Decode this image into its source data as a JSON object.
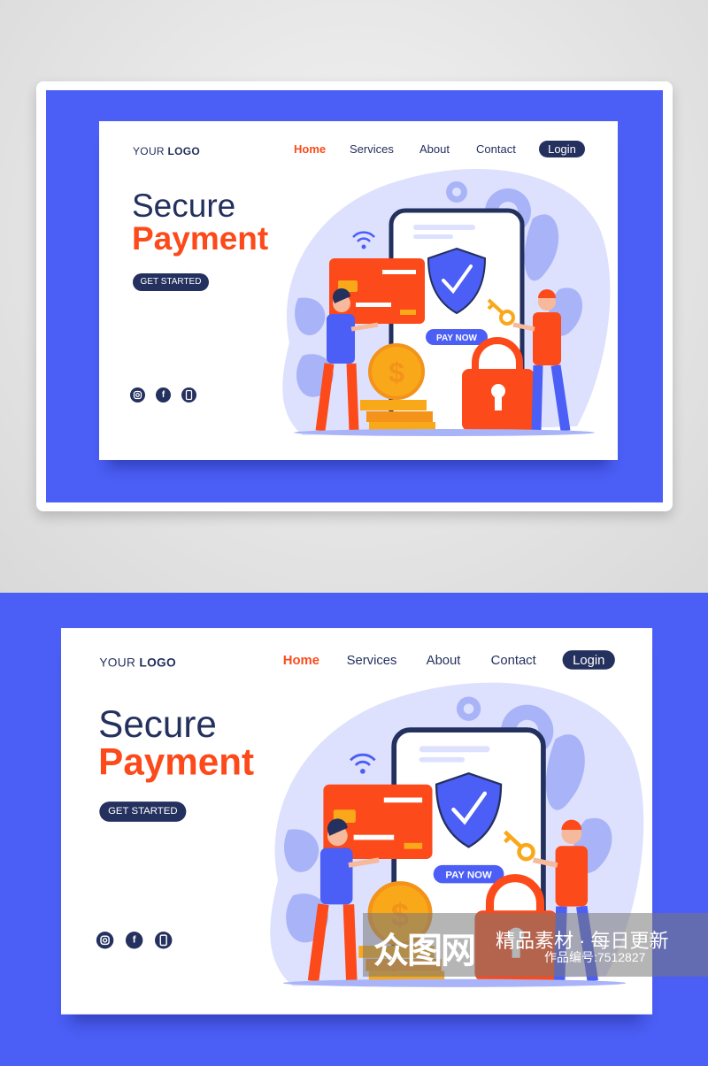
{
  "logo": {
    "your": "YOUR",
    "logo": "LOGO"
  },
  "nav": {
    "items": [
      "Home",
      "Services",
      "About",
      "Contact"
    ],
    "login": "Login"
  },
  "hero": {
    "line1": "Secure",
    "line2": "Payment",
    "cta": "GET STARTED"
  },
  "illustration": {
    "pay_now": "PAY NOW",
    "currency": "$"
  },
  "social": {
    "icons": [
      "instagram-icon",
      "facebook-icon",
      "phone-icon"
    ],
    "facebook_glyph": "f"
  },
  "colors": {
    "primary": "#24305e",
    "accent": "#fc4a1a",
    "blue": "#4b5ef5",
    "gold": "#f9a81a"
  },
  "watermark": {
    "brand": "众图网",
    "tagline": "精品素材 · 每日更新",
    "id": "作品编号:7512827"
  }
}
